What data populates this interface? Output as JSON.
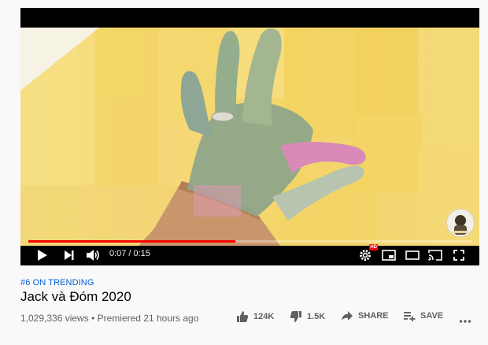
{
  "player": {
    "current_time": "0:07",
    "separator": "/",
    "duration": "0:15",
    "progress_fraction": 0.4667,
    "hd_label": "HD"
  },
  "video": {
    "trending_label": "#6 ON TRENDING",
    "title": "Jack và Đóm 2020",
    "views": "1,029,336 views",
    "bullet": "•",
    "premiered": "Premiered 21 hours ago"
  },
  "actions": {
    "likes": "124K",
    "dislikes": "1.5K",
    "share_label": "SHARE",
    "save_label": "SAVE"
  },
  "colors": {
    "progress": "#ff0000",
    "link": "#065fd4",
    "text_secondary": "#606060"
  },
  "icons": [
    "play-icon",
    "next-icon",
    "volume-icon",
    "settings-icon",
    "miniplayer-icon",
    "theater-icon",
    "cast-icon",
    "fullscreen-icon",
    "like-icon",
    "dislike-icon",
    "share-icon",
    "save-icon",
    "more-icon"
  ]
}
